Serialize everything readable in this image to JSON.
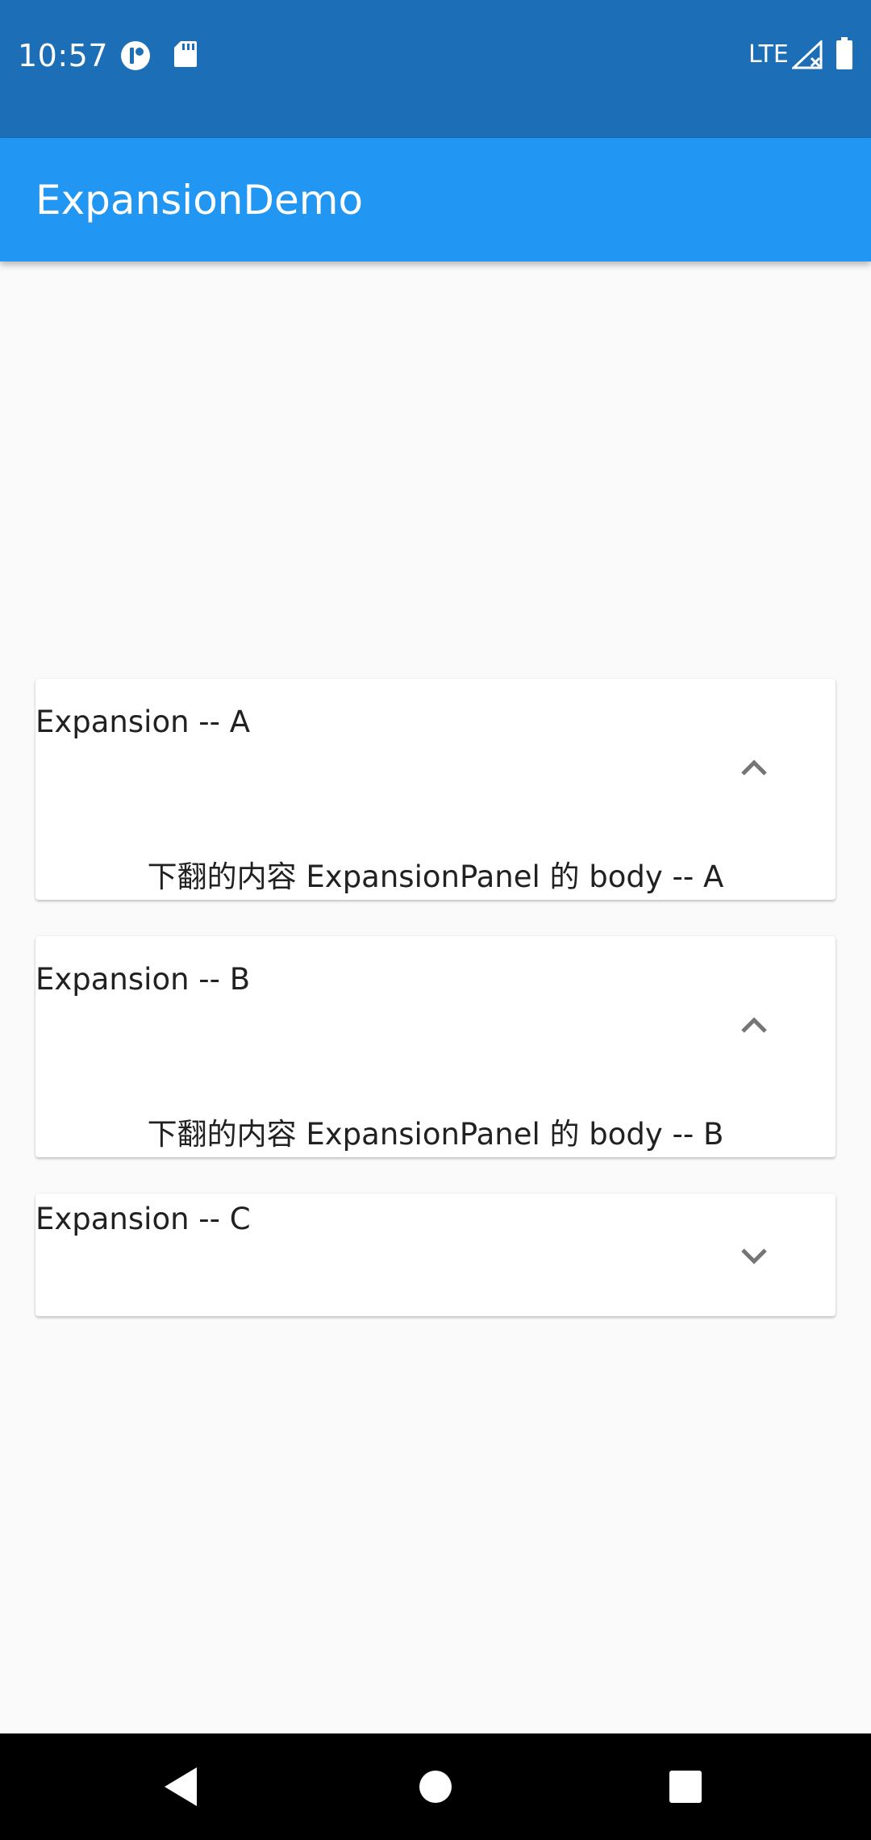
{
  "status_bar": {
    "time": "10:57",
    "network": "LTE",
    "icons": [
      "app-notification-icon",
      "sd-card-icon",
      "signal-icon",
      "battery-icon"
    ],
    "background": "#1c6fb7"
  },
  "app_bar": {
    "title": "ExpansionDemo",
    "background": "#2196f3"
  },
  "panels": [
    {
      "header": "Expansion -- A",
      "body": "下翻的内容 ExpansionPanel 的 body -- A",
      "expanded": true,
      "icon": "chevron-up-icon"
    },
    {
      "header": "Expansion -- B",
      "body": "下翻的内容 ExpansionPanel 的 body -- B",
      "expanded": true,
      "icon": "chevron-up-icon"
    },
    {
      "header": "Expansion -- C",
      "expanded": false,
      "icon": "chevron-down-icon"
    }
  ],
  "nav_bar": {
    "buttons": [
      "back-icon",
      "home-icon",
      "recents-icon"
    ]
  }
}
